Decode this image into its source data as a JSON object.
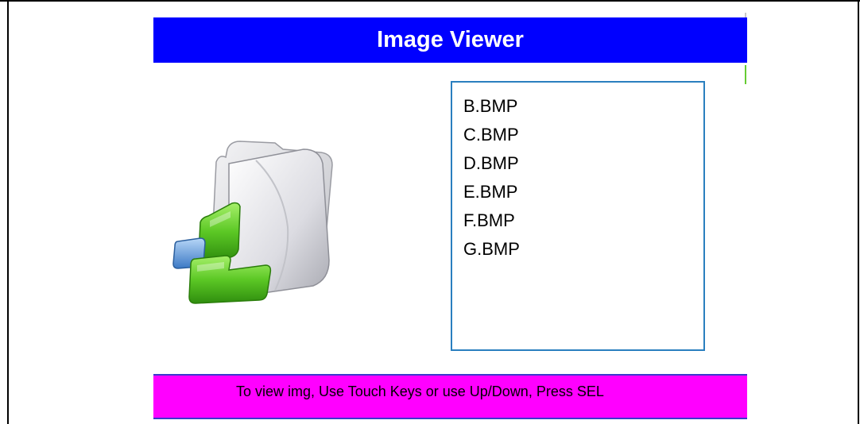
{
  "window": {
    "title": "Image Viewer"
  },
  "file_list": {
    "items": [
      "B.BMP",
      "C.BMP",
      "D.BMP",
      "E.BMP",
      "F.BMP",
      "G.BMP"
    ]
  },
  "status_bar": {
    "text": "To view img, Use Touch Keys or  use Up/Down, Press SEL"
  },
  "icon": {
    "name": "folder-icon"
  },
  "colors": {
    "title_bg": "#0000ff",
    "title_text": "#ffffff",
    "status_bg": "#ff00ff",
    "list_border": "#2a7fbf",
    "accent_green": "#66cc33",
    "accent_blue": "#4a90d9"
  }
}
